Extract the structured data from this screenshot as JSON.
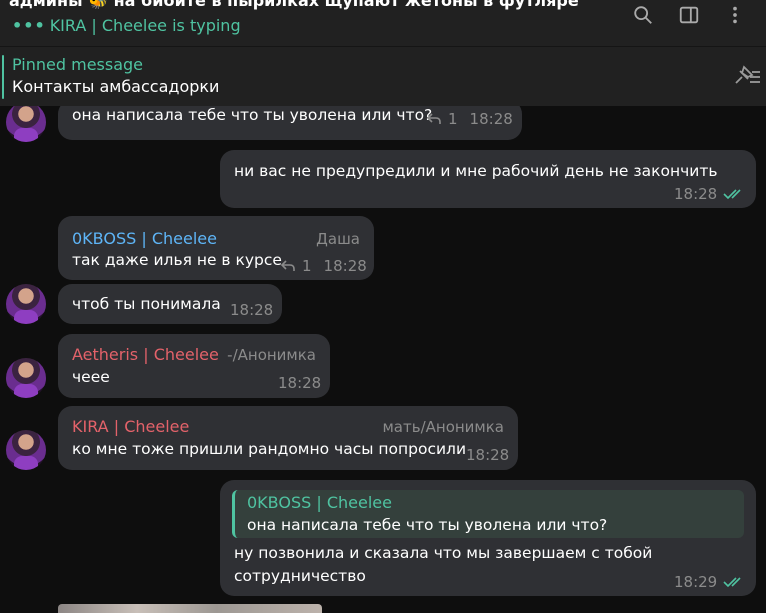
{
  "header": {
    "title": "админы 🐝 на бибите в пырилках щупают жетоны в футляре",
    "typing_dots": "•••",
    "typing_status": "KIRA | Cheelee is typing"
  },
  "pinned": {
    "title": "Pinned message",
    "text": "Контакты амбассадорки"
  },
  "messages": [
    {
      "text": "она написала тебе что ты уволена или что?",
      "replies": "1",
      "time": "18:28"
    },
    {
      "text": "ни вас не предупредили и мне рабочий день не закончить",
      "time": "18:28"
    },
    {
      "sender": "0KBOSS | Cheelee",
      "rank": "Даша",
      "text": "так даже илья не в курсе",
      "replies": "1",
      "time": "18:28"
    },
    {
      "text": "чтоб ты понимала",
      "time": "18:28"
    },
    {
      "sender": "Aetheris | Cheelee",
      "rank": "-/Анонимка",
      "text": "чеее",
      "time": "18:28"
    },
    {
      "sender": "KIRA | Cheelee",
      "rank": "мать/Анонимка",
      "text": "ко мне тоже пришли рандомно часы попросили",
      "time": "18:28"
    },
    {
      "quote_sender": "0KBOSS | Cheelee",
      "quote_text": "она написала тебе что ты уволена или что?",
      "text_line1": "ну позвонила и сказала что мы завершаем с тобой",
      "text_line2": "сотрудничество",
      "time": "18:29"
    }
  ],
  "colors": {
    "accent": "#4fc3a1",
    "bubble": "#2f3034",
    "sender_blue": "#5eb5f7",
    "sender_red": "#e3626a"
  }
}
